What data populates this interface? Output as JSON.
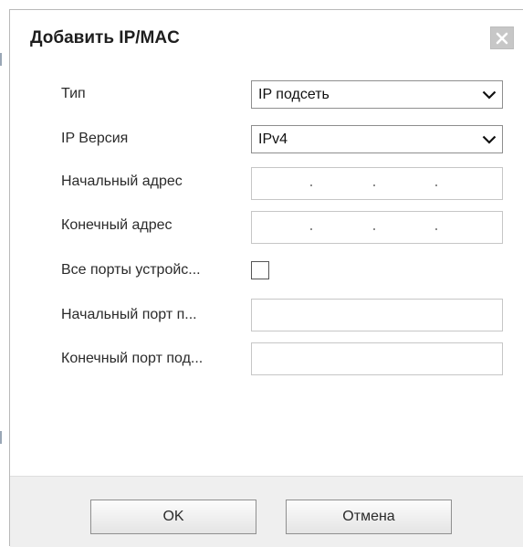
{
  "dialog": {
    "title": "Добавить IP/MAC",
    "close_icon": "close-icon"
  },
  "form": {
    "type": {
      "label": "Тип",
      "value": "IP подсеть"
    },
    "ip_version": {
      "label": "IP Версия",
      "value": "IPv4"
    },
    "start_address": {
      "label": "Начальный адрес",
      "value": ""
    },
    "end_address": {
      "label": "Конечный адрес",
      "value": ""
    },
    "all_ports": {
      "label": "Все порты устройс...",
      "checked": false
    },
    "start_port": {
      "label": "Начальный порт п...",
      "value": ""
    },
    "end_port": {
      "label": "Конечный порт под...",
      "value": ""
    }
  },
  "buttons": {
    "ok": "OK",
    "cancel": "Отмена"
  },
  "colors": {
    "footer": "#efefef",
    "close_button": "#c7c7c7",
    "field_border": "#c6c6c6"
  }
}
